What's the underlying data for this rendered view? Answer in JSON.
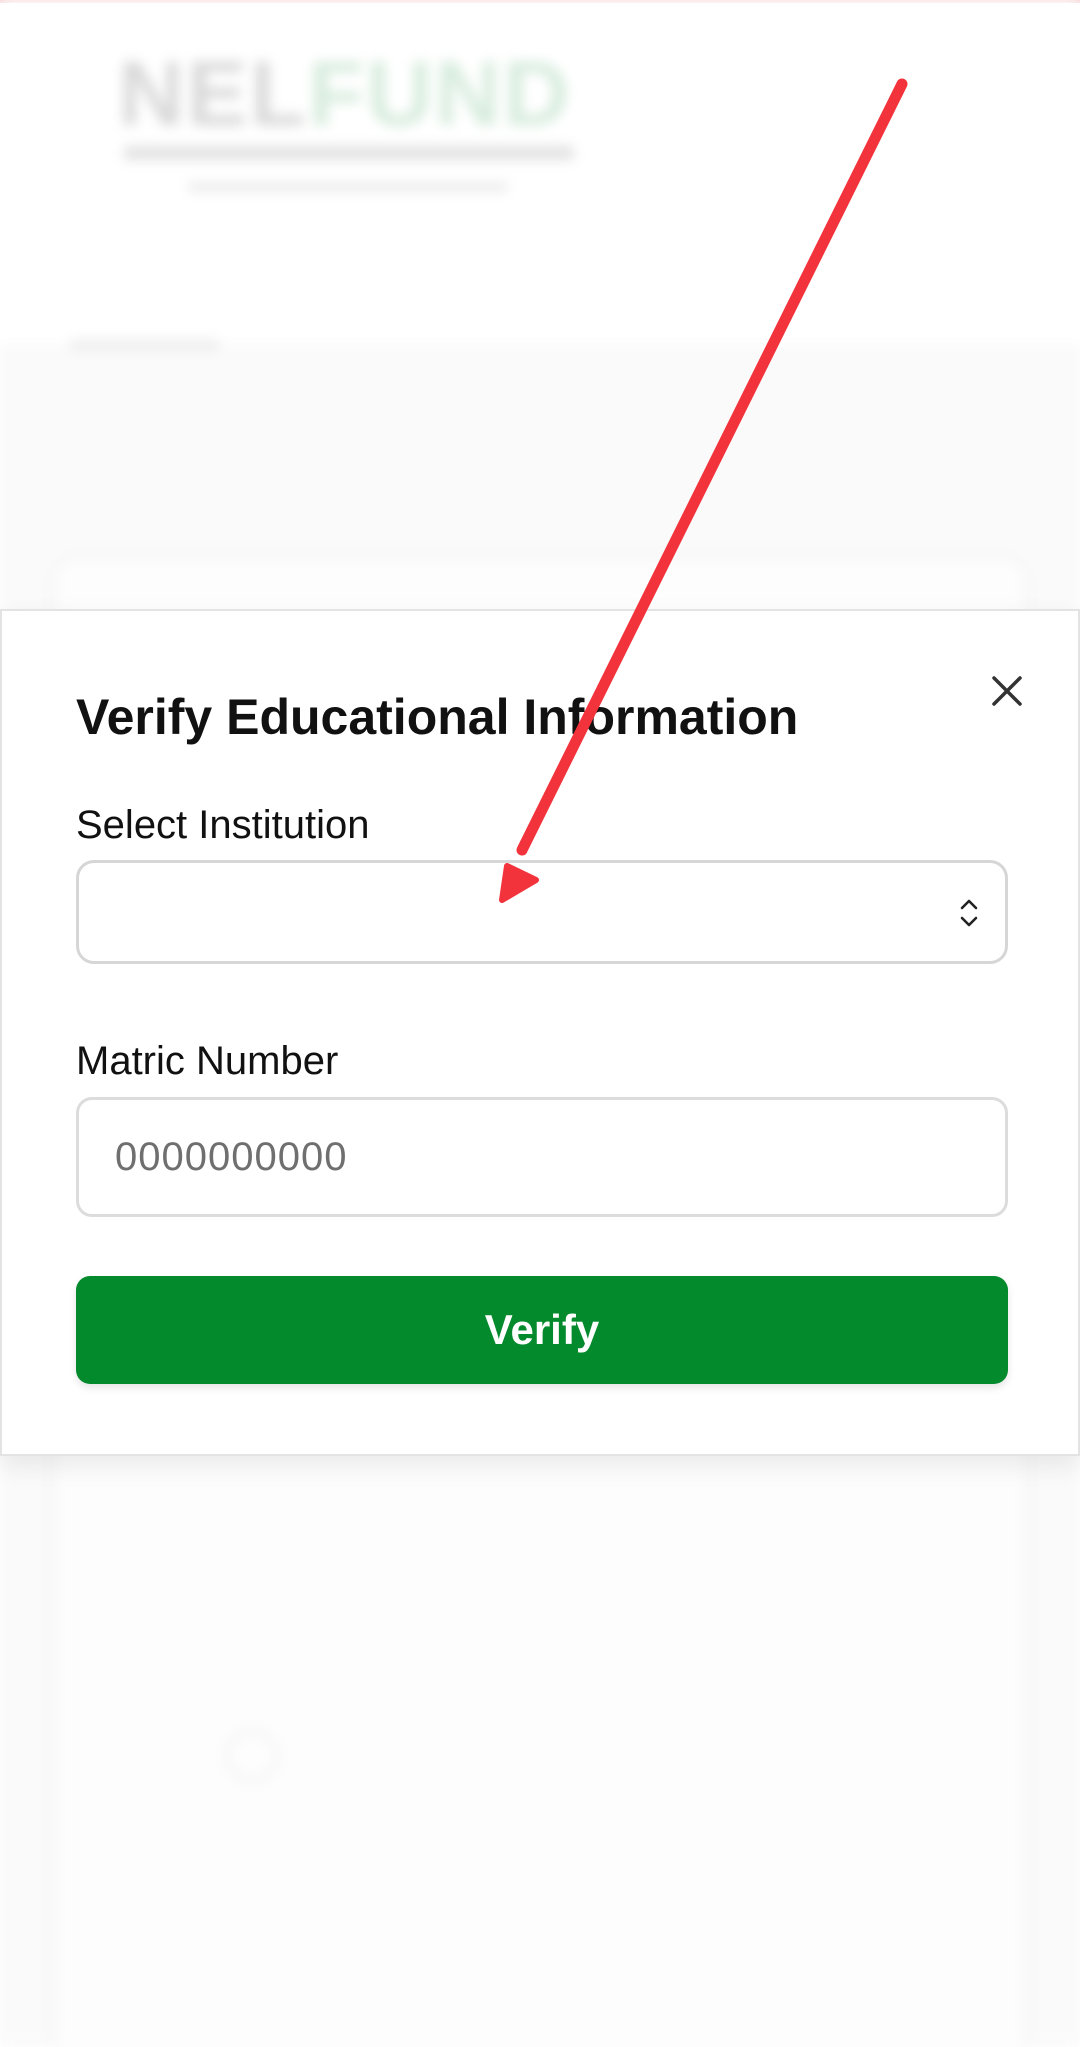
{
  "background": {
    "logo": {
      "part1": "NEL",
      "part2": "FUND"
    }
  },
  "modal": {
    "title": "Verify Educational Information",
    "close_icon": "close-icon",
    "institution": {
      "label": "Select Institution",
      "value": "",
      "icon": "chevron-updown-icon"
    },
    "matric": {
      "label": "Matric Number",
      "placeholder": "0000000000",
      "value": ""
    },
    "verify_label": "Verify"
  },
  "colors": {
    "primary_green": "#038a2c",
    "annotation_red": "#f3333b",
    "input_border": "#d6d6d6"
  }
}
